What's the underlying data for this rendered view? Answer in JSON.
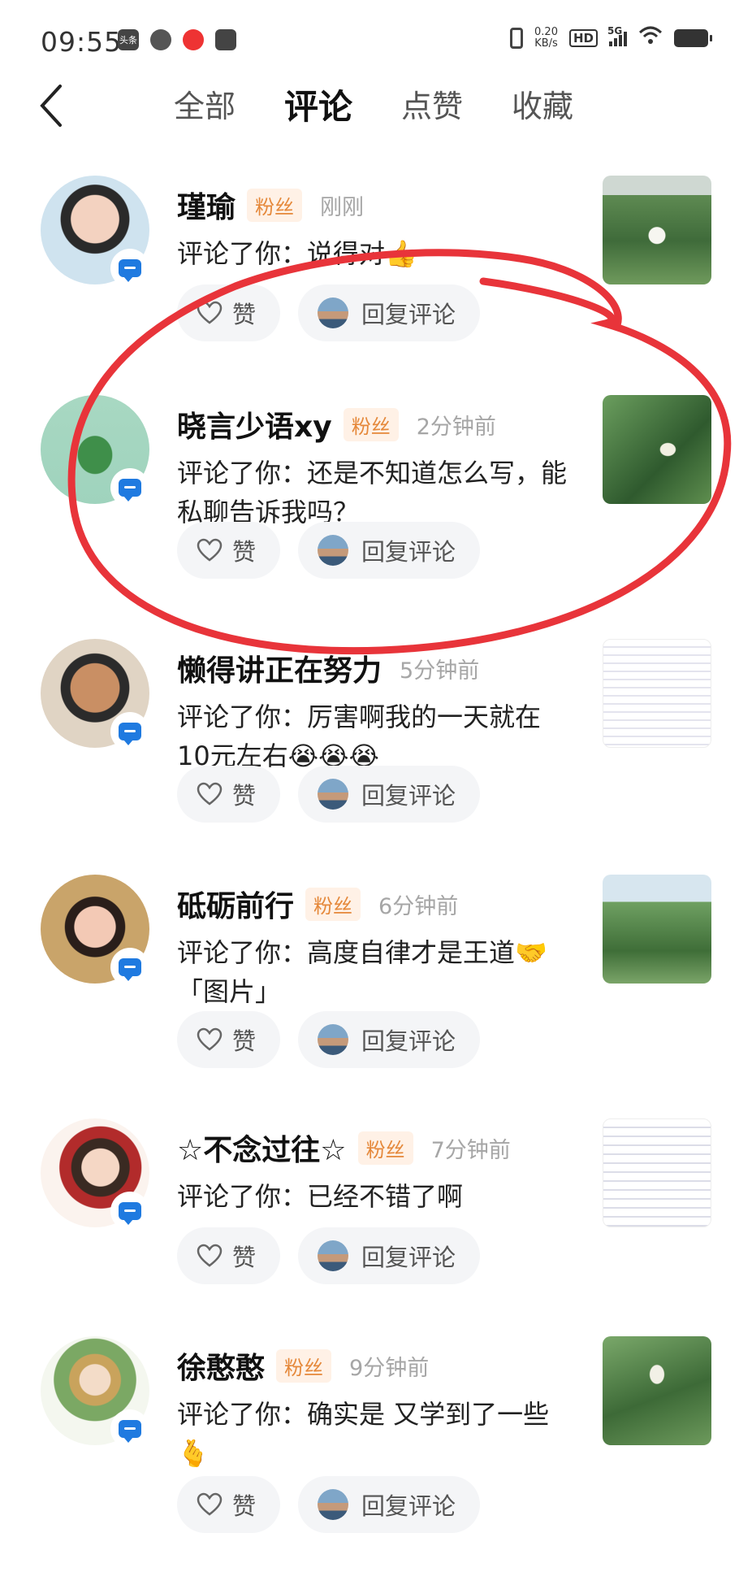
{
  "status_bar": {
    "time": "09:55",
    "apps": [
      "头条",
      "",
      "",
      ""
    ],
    "net_speed_value": "0.20",
    "net_speed_unit": "KB/s",
    "hd": "HD",
    "network": "5G"
  },
  "nav": {
    "back_icon": "chevron-left-icon",
    "tabs": [
      {
        "label": "全部",
        "active": false
      },
      {
        "label": "评论",
        "active": true
      },
      {
        "label": "点赞",
        "active": false
      },
      {
        "label": "收藏",
        "active": false
      }
    ]
  },
  "common": {
    "fan_tag": "粉丝",
    "like_label": "赞",
    "reply_label": "回复评论"
  },
  "items": [
    {
      "name": "瑾瑜",
      "time": "刚刚",
      "comment": "评论了你：说得对👍"
    },
    {
      "name": "晓言少语xy",
      "time": "2分钟前",
      "comment": "评论了你：还是不知道怎么写，能私聊告诉我吗？"
    },
    {
      "name": "懒得讲正在努力",
      "time": "5分钟前",
      "comment": "评论了你：厉害啊我的一天就在10元左右😭😭😭"
    },
    {
      "name": "砥砺前行",
      "time": "6分钟前",
      "comment": "评论了你：高度自律才是王道🤝「图片」"
    },
    {
      "name": "☆不念过往☆",
      "time": "7分钟前",
      "comment": "评论了你：已经不错了啊"
    },
    {
      "name": "徐憨憨",
      "time": "9分钟前",
      "comment": "评论了你：确实是 又学到了一些🫰"
    }
  ],
  "colors": {
    "accent_badge": "#1f7ae0",
    "fan_tag_bg": "#fff1e6",
    "fan_tag_text": "#e5883a",
    "annotation_red": "#e8343a"
  }
}
